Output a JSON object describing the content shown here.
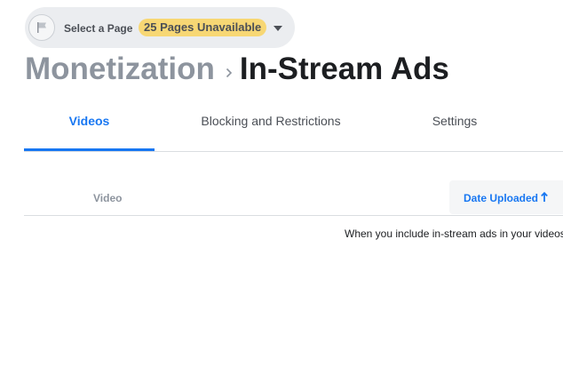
{
  "page_selector": {
    "label": "Select a Page",
    "badge": "25 Pages Unavailable"
  },
  "breadcrumb": {
    "parent": "Monetization",
    "current": "In-Stream Ads"
  },
  "tabs": [
    {
      "label": "Videos",
      "active": true
    },
    {
      "label": "Blocking and Restrictions",
      "active": false
    },
    {
      "label": "Settings",
      "active": false
    }
  ],
  "table": {
    "columns": {
      "video": "Video",
      "date_uploaded": "Date Uploaded"
    },
    "sort_direction": "ascending",
    "empty_message": "When you include in-stream ads in your videos"
  },
  "colors": {
    "accent": "#1877f2",
    "badge": "#f7d774",
    "pill_bg": "#ebedf0"
  }
}
